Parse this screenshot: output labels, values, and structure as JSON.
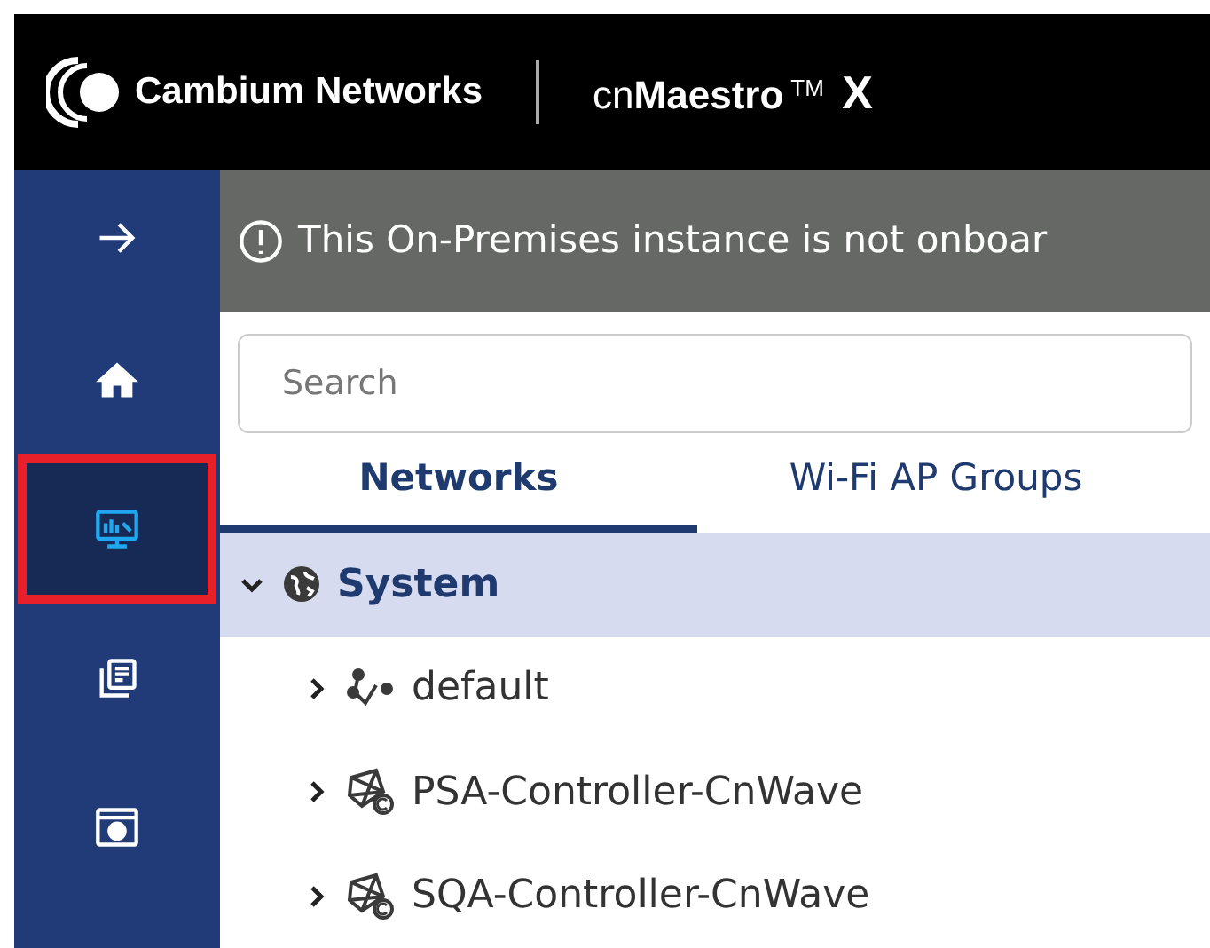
{
  "header": {
    "brand": "Cambium Networks",
    "product_prefix": "cn",
    "product_name": "Maestro",
    "trademark": "TM",
    "product_suffix": "X"
  },
  "sidebar": {
    "items": [
      {
        "kind": "collapse",
        "selected": false
      },
      {
        "kind": "home",
        "selected": false
      },
      {
        "kind": "monitor",
        "selected": true
      },
      {
        "kind": "list",
        "selected": false
      },
      {
        "kind": "window",
        "selected": false
      }
    ]
  },
  "banner": {
    "text": "This On-Premises instance is not onboar"
  },
  "search": {
    "placeholder": "Search"
  },
  "tabs": [
    {
      "label": "Networks",
      "selected": true
    },
    {
      "label": "Wi-Fi AP Groups",
      "selected": false
    }
  ],
  "tree": [
    {
      "label": "System",
      "kind": "system",
      "expanded": true,
      "selected": true,
      "children": [
        {
          "label": "default",
          "kind": "network",
          "expanded": false,
          "selected": false
        },
        {
          "label": "PSA-Controller-CnWave",
          "kind": "controller",
          "expanded": false,
          "selected": false
        },
        {
          "label": "SQA-Controller-CnWave",
          "kind": "controller",
          "expanded": false,
          "selected": false
        }
      ]
    }
  ]
}
